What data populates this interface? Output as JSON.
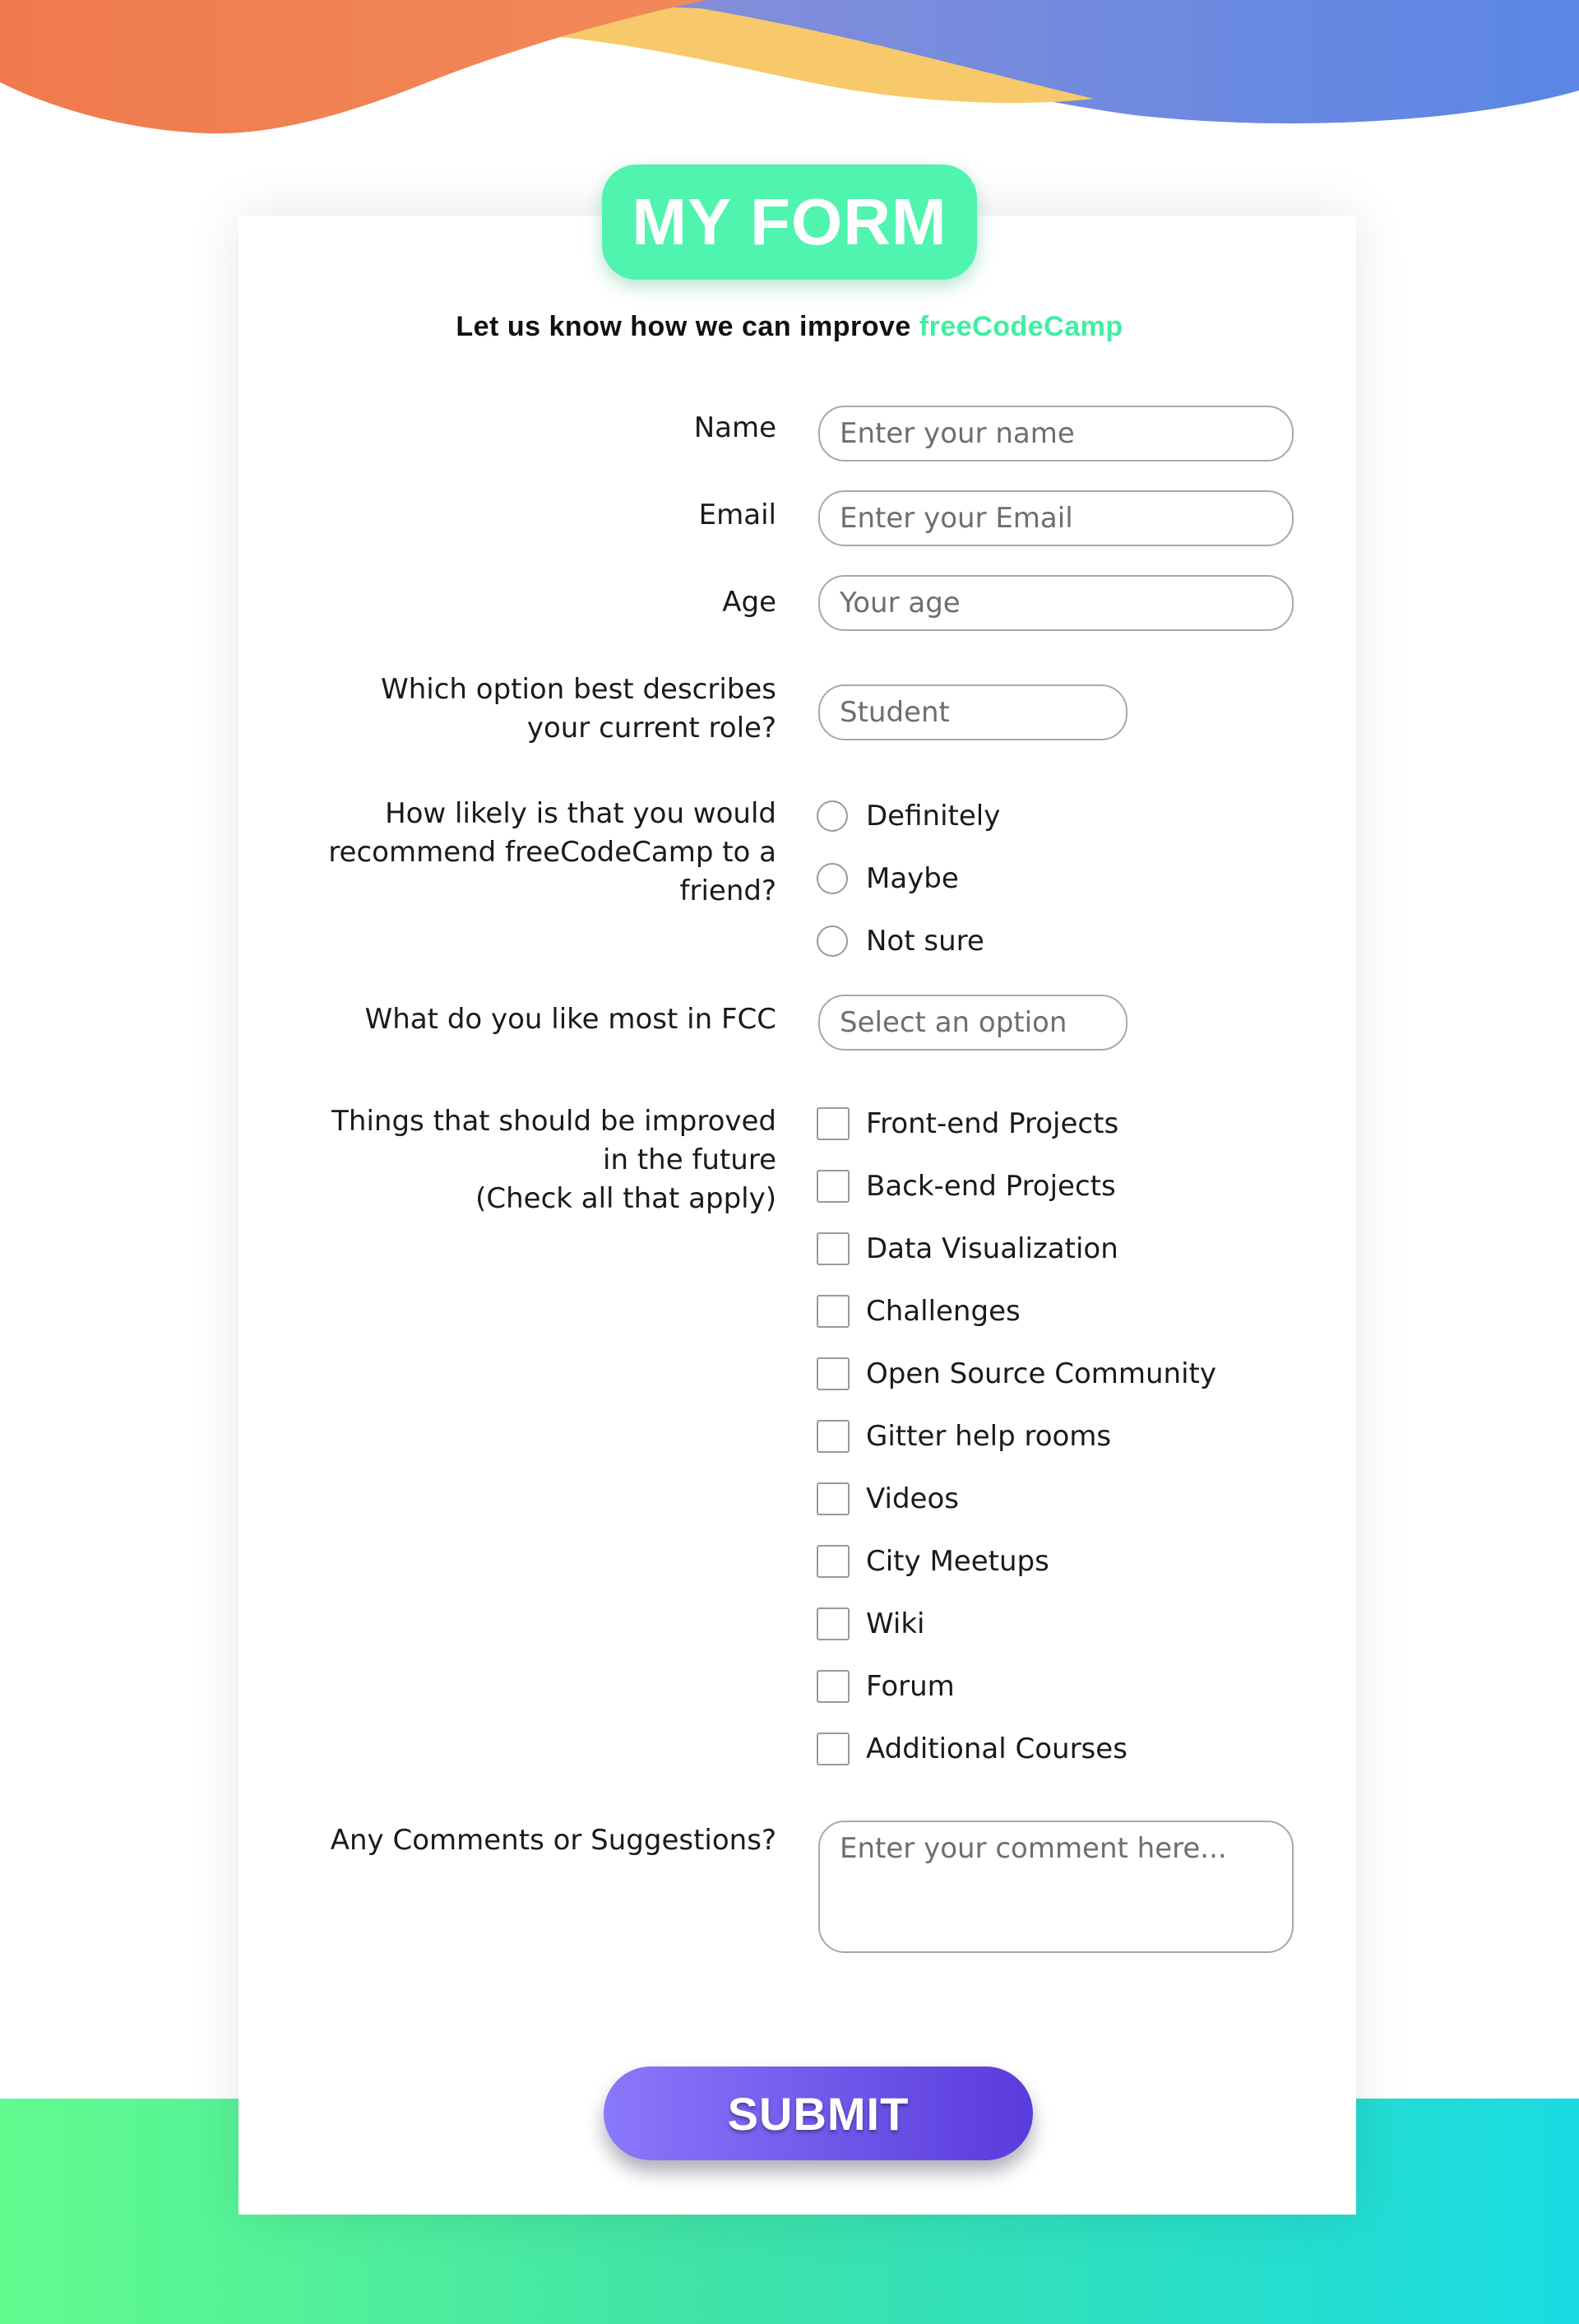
{
  "colors": {
    "accent_green": "#4ff4ae",
    "submit_gradient_start": "#8a78fb",
    "submit_gradient_end": "#5a3bdc",
    "wave_orange": "#f07a4d",
    "wave_blue": "#5b86e5",
    "wave_yellow": "#f7c96a",
    "bottom_band_start": "#62fb8f",
    "bottom_band_end": "#19dbe2"
  },
  "header": {
    "title": "MY FORM",
    "subtitle_prefix": "Let us know how we can improve ",
    "subtitle_highlight": "freeCodeCamp"
  },
  "form": {
    "name": {
      "label": "Name",
      "placeholder": "Enter your name"
    },
    "email": {
      "label": "Email",
      "placeholder": "Enter your Email"
    },
    "age": {
      "label": "Age",
      "placeholder": "Your age"
    },
    "role": {
      "label": "Which option best describes your current role?",
      "selected": "Student"
    },
    "recommend": {
      "label": "How likely is that you would recommend freeCodeCamp to a friend?",
      "options": [
        "Definitely",
        "Maybe",
        "Not sure"
      ]
    },
    "like_most": {
      "label": "What do you like most in FCC",
      "selected": "Select an option"
    },
    "improve": {
      "label": "Things that should be improved in the future",
      "label_note": "(Check all that apply)",
      "options": [
        "Front-end Projects",
        "Back-end Projects",
        "Data Visualization",
        "Challenges",
        "Open Source Community",
        "Gitter help rooms",
        "Videos",
        "City Meetups",
        "Wiki",
        "Forum",
        "Additional Courses"
      ]
    },
    "comments": {
      "label": "Any Comments or Suggestions?",
      "placeholder": "Enter your comment here..."
    },
    "submit_label": "SUBMIT"
  }
}
